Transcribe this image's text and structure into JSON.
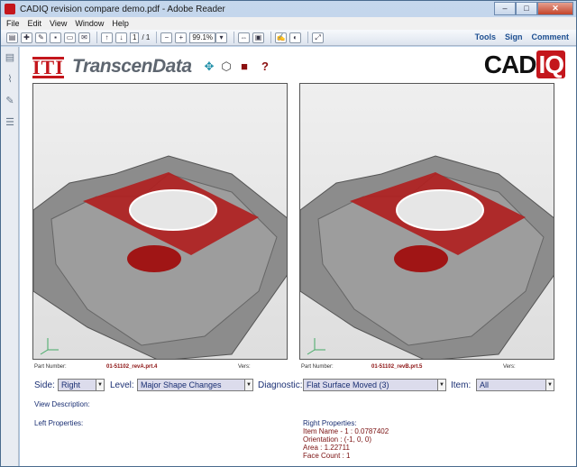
{
  "window": {
    "title": "CADIQ revision compare demo.pdf - Adobe Reader",
    "controls": [
      "–",
      "□",
      "✕"
    ]
  },
  "menu": [
    "File",
    "Edit",
    "View",
    "Window",
    "Help"
  ],
  "toolbar": {
    "page_current": "1",
    "page_total": "/ 1",
    "zoom": "99.1%",
    "links": [
      "Tools",
      "Sign",
      "Comment"
    ]
  },
  "header": {
    "logo_iti": "ITI",
    "logo_transcendata": "TranscenData",
    "help": "?",
    "logo_cad": "CAD",
    "logo_iq": "IQ"
  },
  "left_panel": {
    "part_number_label": "Part Number:",
    "part_number": "01-51102_revA.prt.4",
    "vers_label": "Vers:"
  },
  "right_panel": {
    "part_number_label": "Part Number:",
    "part_number": "01-51102_revB.prt.5",
    "vers_label": "Vers:"
  },
  "controls": {
    "side_label": "Side:",
    "side_value": "Right",
    "level_label": "Level:",
    "level_value": "Major Shape Changes",
    "diagnostic_label": "Diagnostic:",
    "diagnostic_value": "Flat Surface Moved (3)",
    "item_label": "Item:",
    "item_value": "All"
  },
  "view_description_label": "View Description:",
  "left_properties_label": "Left Properties:",
  "right_properties": {
    "heading": "Right Properties:",
    "lines": [
      "Item Name - 1 : 0.0787402",
      "Orientation  : (-1, 0, 0)",
      "Area         : 1.22711",
      "Face Count  : 1"
    ]
  },
  "colors": {
    "highlight": "#b01e1e",
    "model_gray": "#8a8a8a",
    "brand_red": "#c4161c"
  }
}
